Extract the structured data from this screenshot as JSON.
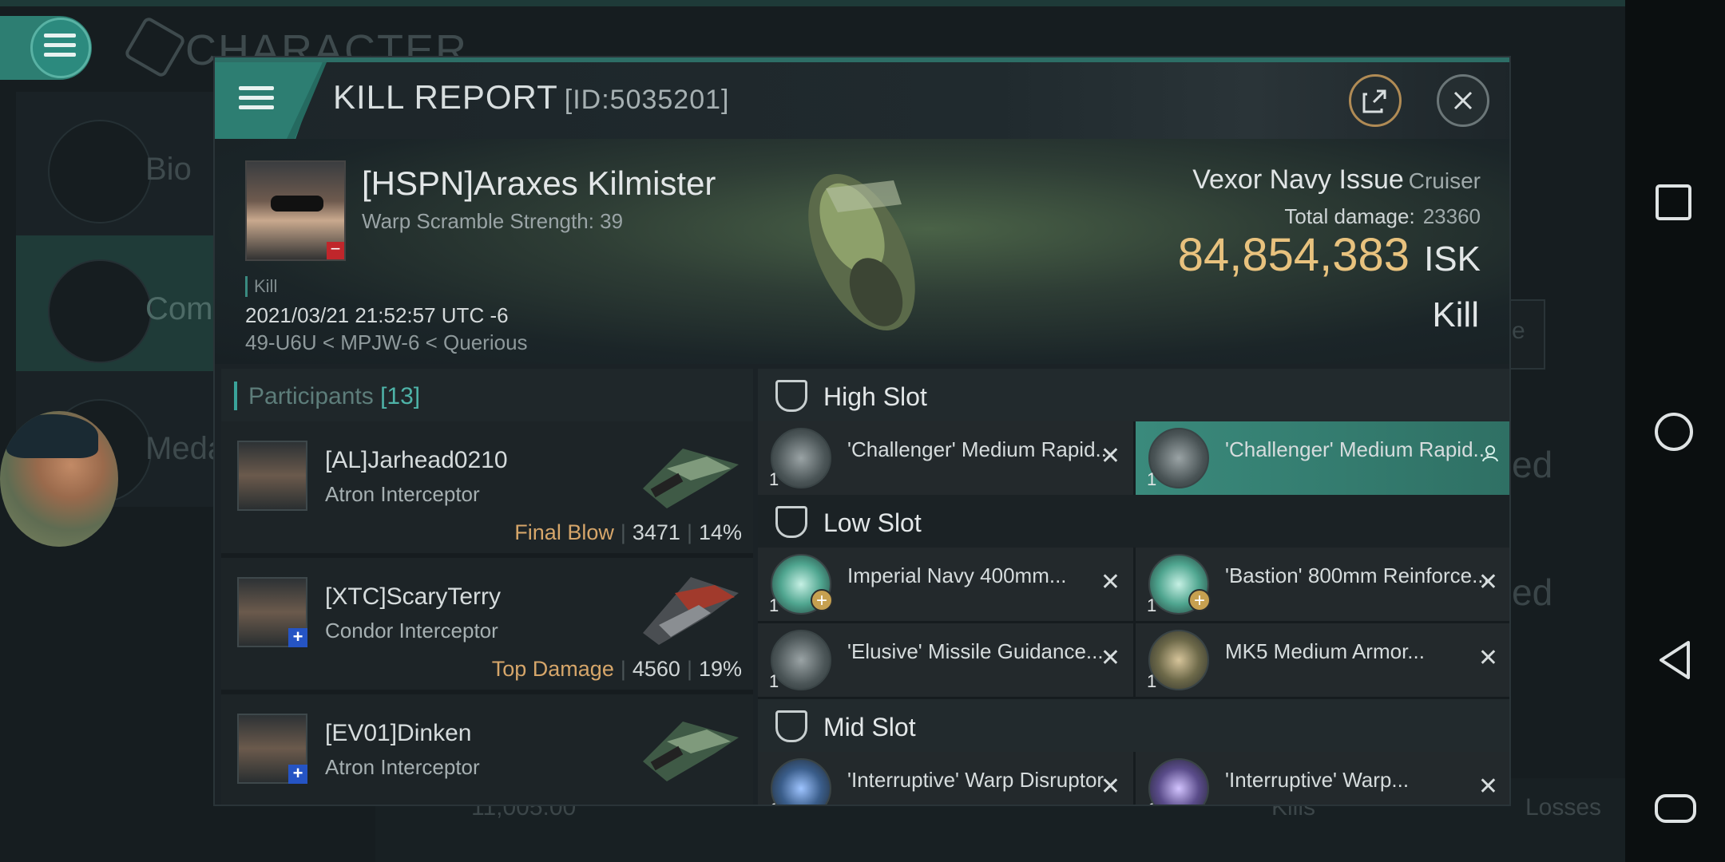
{
  "background": {
    "title": "CHARACTER",
    "nav_items": [
      {
        "label": "Bio"
      },
      {
        "label": "Com"
      },
      {
        "label": "Meda"
      }
    ],
    "right_fragments": [
      "e",
      "ed",
      "ed"
    ],
    "bottom": {
      "value": "11,005.00",
      "kills": "Kills",
      "losses": "Losses"
    }
  },
  "modal": {
    "title": "KILL REPORT",
    "id": "[ID:5035201]",
    "victim": {
      "name": "[HSPN]Araxes Kilmister",
      "warp": "Warp Scramble Strength: 39",
      "kill_tag": "Kill",
      "date": "2021/03/21 21:52:57 UTC -6",
      "location": "49-U6U < MPJW-6 < Querious"
    },
    "ship": {
      "name": "Vexor Navy Issue",
      "class": "Cruiser",
      "total_damage_label": "Total damage:",
      "total_damage": "23360",
      "isk_value": "84,854,383",
      "isk_unit": "ISK",
      "result": "Kill"
    },
    "participants": {
      "title": "Participants",
      "count": "[13]",
      "rows": [
        {
          "name": "[AL]Jarhead0210",
          "ship": "Atron Interceptor",
          "tag": "Final Blow",
          "damage": "3471",
          "percent": "14%"
        },
        {
          "name": "[XTC]ScaryTerry",
          "ship": "Condor Interceptor",
          "tag": "Top Damage",
          "damage": "4560",
          "percent": "19%"
        },
        {
          "name": "[EV01]Dinken",
          "ship": "Atron Interceptor",
          "tag": "",
          "damage": "",
          "percent": ""
        }
      ]
    },
    "slots": {
      "high": {
        "label": "High Slot",
        "items": [
          {
            "name": "'Challenger' Medium Rapid...",
            "qty": "1"
          },
          {
            "name": "'Challenger' Medium Rapid...",
            "qty": "1"
          }
        ]
      },
      "low": {
        "label": "Low Slot",
        "items": [
          {
            "name": "Imperial Navy 400mm...",
            "qty": "1"
          },
          {
            "name": "'Bastion' 800mm Reinforce...",
            "qty": "1"
          },
          {
            "name": "'Elusive' Missile Guidance...",
            "qty": "1"
          },
          {
            "name": "MK5 Medium Armor...",
            "qty": "1"
          }
        ]
      },
      "mid": {
        "label": "Mid Slot",
        "items": [
          {
            "name": "'Interruptive' Warp Disruptor",
            "qty": "1"
          },
          {
            "name": "'Interruptive' Warp...",
            "qty": "1"
          }
        ]
      }
    }
  },
  "colors": {
    "accent": "#2d7e72",
    "isk": "#e8c27e",
    "final_blow": "#d6a66a",
    "highlight": "#3a8a7c"
  }
}
